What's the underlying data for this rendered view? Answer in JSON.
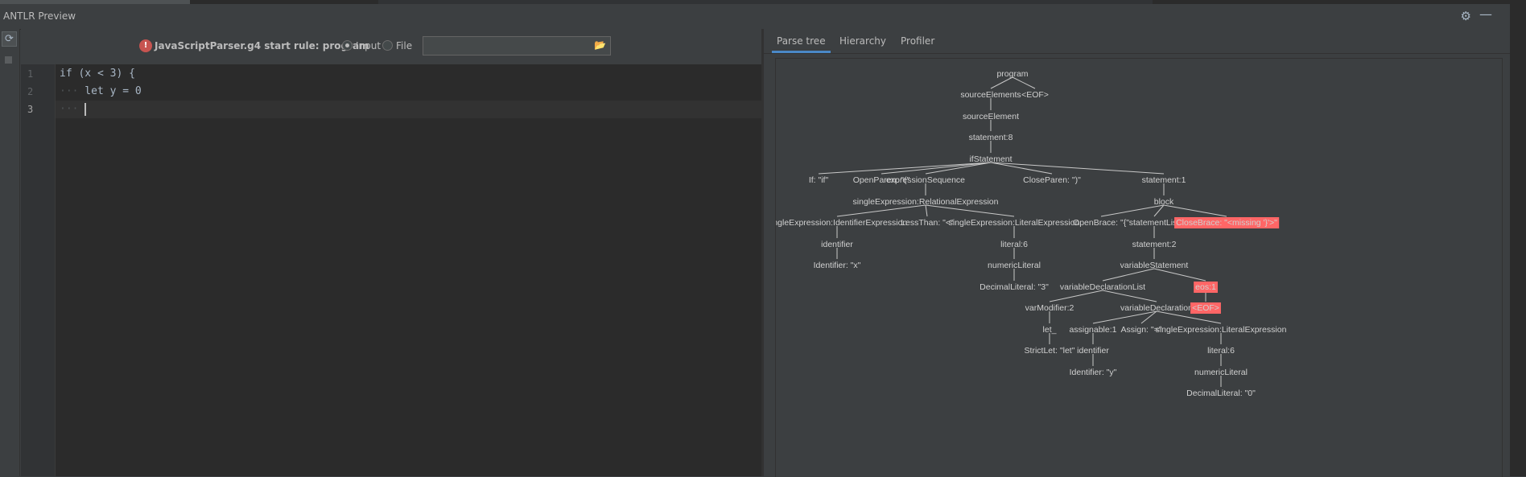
{
  "window": {
    "title": "ANTLR Preview"
  },
  "input_bar": {
    "grammar_label": "JavaScriptParser.g4 start rule: program",
    "radio_input": "Input",
    "radio_file": "File",
    "file_path": ""
  },
  "editor": {
    "lines": [
      {
        "num": "1",
        "indent": "",
        "text": "if (x < 3) {"
      },
      {
        "num": "2",
        "indent": "···",
        "text": " let y = 0"
      },
      {
        "num": "3",
        "indent": "···",
        "text": ""
      }
    ]
  },
  "tabs": [
    "Parse tree",
    "Hierarchy",
    "Profiler"
  ],
  "colors": {
    "error_node": "#ff6666",
    "accent": "#4a88c7"
  },
  "parse_tree": {
    "nodes": [
      {
        "id": 0,
        "label": "program",
        "parent": null,
        "error": false
      },
      {
        "id": 1,
        "label": "sourceElements",
        "parent": 0,
        "error": false
      },
      {
        "id": 2,
        "label": "<EOF>",
        "parent": 0,
        "error": false
      },
      {
        "id": 3,
        "label": "sourceElement",
        "parent": 1,
        "error": false
      },
      {
        "id": 4,
        "label": "statement:8",
        "parent": 3,
        "error": false
      },
      {
        "id": 5,
        "label": "ifStatement",
        "parent": 4,
        "error": false
      },
      {
        "id": 6,
        "label": "If: \"if\"",
        "parent": 5,
        "error": false
      },
      {
        "id": 7,
        "label": "OpenParen: \"(\"",
        "parent": 5,
        "error": false
      },
      {
        "id": 8,
        "label": "expressionSequence",
        "parent": 5,
        "error": false
      },
      {
        "id": 9,
        "label": "CloseParen: \")\"",
        "parent": 5,
        "error": false
      },
      {
        "id": 10,
        "label": "statement:1",
        "parent": 5,
        "error": false
      },
      {
        "id": 11,
        "label": "singleExpression:RelationalExpression",
        "parent": 8,
        "error": false
      },
      {
        "id": 12,
        "label": "block",
        "parent": 10,
        "error": false
      },
      {
        "id": 13,
        "label": "singleExpression:IdentifierExpression",
        "parent": 11,
        "error": false
      },
      {
        "id": 14,
        "label": "LessThan: \"<\"",
        "parent": 11,
        "error": false
      },
      {
        "id": 15,
        "label": "singleExpression:LiteralExpression",
        "parent": 11,
        "error": false
      },
      {
        "id": 16,
        "label": "OpenBrace: \"{\"",
        "parent": 12,
        "error": false
      },
      {
        "id": 17,
        "label": "statementList",
        "parent": 12,
        "error": false
      },
      {
        "id": 18,
        "label": "CloseBrace: \"<missing '}'>\"",
        "parent": 12,
        "error": true
      },
      {
        "id": 19,
        "label": "identifier",
        "parent": 13,
        "error": false
      },
      {
        "id": 20,
        "label": "literal:6",
        "parent": 15,
        "error": false
      },
      {
        "id": 21,
        "label": "statement:2",
        "parent": 17,
        "error": false
      },
      {
        "id": 22,
        "label": "Identifier: \"x\"",
        "parent": 19,
        "error": false
      },
      {
        "id": 23,
        "label": "numericLiteral",
        "parent": 20,
        "error": false
      },
      {
        "id": 24,
        "label": "variableStatement",
        "parent": 21,
        "error": false
      },
      {
        "id": 25,
        "label": "DecimalLiteral: \"3\"",
        "parent": 23,
        "error": false
      },
      {
        "id": 26,
        "label": "variableDeclarationList",
        "parent": 24,
        "error": false
      },
      {
        "id": 27,
        "label": "eos:1",
        "parent": 24,
        "error": true
      },
      {
        "id": 28,
        "label": "varModifier:2",
        "parent": 26,
        "error": false
      },
      {
        "id": 29,
        "label": "variableDeclaration",
        "parent": 26,
        "error": false
      },
      {
        "id": 30,
        "label": "<EOF>",
        "parent": 27,
        "error": true
      },
      {
        "id": 31,
        "label": "let_",
        "parent": 28,
        "error": false
      },
      {
        "id": 32,
        "label": "assignable:1",
        "parent": 29,
        "error": false
      },
      {
        "id": 33,
        "label": "Assign: \"=\"",
        "parent": 29,
        "error": false
      },
      {
        "id": 34,
        "label": "singleExpression:LiteralExpression",
        "parent": 29,
        "error": false
      },
      {
        "id": 35,
        "label": "StrictLet: \"let\"",
        "parent": 31,
        "error": false
      },
      {
        "id": 36,
        "label": "identifier",
        "parent": 32,
        "error": false
      },
      {
        "id": 37,
        "label": "literal:6",
        "parent": 34,
        "error": false
      },
      {
        "id": 38,
        "label": "Identifier: \"y\"",
        "parent": 36,
        "error": false
      },
      {
        "id": 39,
        "label": "numericLiteral",
        "parent": 37,
        "error": false
      },
      {
        "id": 40,
        "label": "DecimalLiteral: \"0\"",
        "parent": 39,
        "error": false
      }
    ]
  }
}
